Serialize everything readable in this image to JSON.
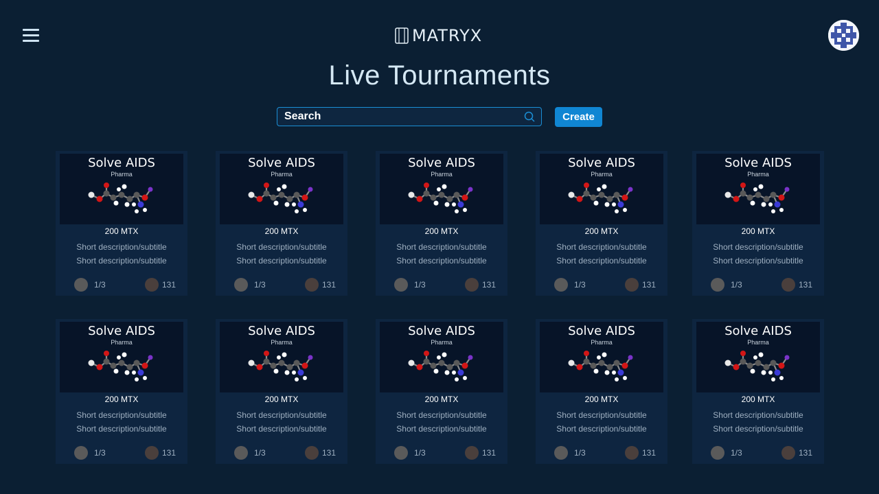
{
  "header": {
    "logo_text": "MATRYX",
    "title": "Live Tournaments"
  },
  "search": {
    "placeholder": "Search"
  },
  "toolbar": {
    "create_label": "Create"
  },
  "tournaments": [
    {
      "title": "Solve AIDS",
      "category": "Pharma",
      "reward": "200 MTX",
      "desc1": "Short description/subtitle",
      "desc2": "Short description/subtitle",
      "rounds": "1/3",
      "entries": "131"
    },
    {
      "title": "Solve AIDS",
      "category": "Pharma",
      "reward": "200 MTX",
      "desc1": "Short description/subtitle",
      "desc2": "Short description/subtitle",
      "rounds": "1/3",
      "entries": "131"
    },
    {
      "title": "Solve AIDS",
      "category": "Pharma",
      "reward": "200 MTX",
      "desc1": "Short description/subtitle",
      "desc2": "Short description/subtitle",
      "rounds": "1/3",
      "entries": "131"
    },
    {
      "title": "Solve AIDS",
      "category": "Pharma",
      "reward": "200 MTX",
      "desc1": "Short description/subtitle",
      "desc2": "Short description/subtitle",
      "rounds": "1/3",
      "entries": "131"
    },
    {
      "title": "Solve AIDS",
      "category": "Pharma",
      "reward": "200 MTX",
      "desc1": "Short description/subtitle",
      "desc2": "Short description/subtitle",
      "rounds": "1/3",
      "entries": "131"
    },
    {
      "title": "Solve AIDS",
      "category": "Pharma",
      "reward": "200 MTX",
      "desc1": "Short description/subtitle",
      "desc2": "Short description/subtitle",
      "rounds": "1/3",
      "entries": "131"
    },
    {
      "title": "Solve AIDS",
      "category": "Pharma",
      "reward": "200 MTX",
      "desc1": "Short description/subtitle",
      "desc2": "Short description/subtitle",
      "rounds": "1/3",
      "entries": "131"
    },
    {
      "title": "Solve AIDS",
      "category": "Pharma",
      "reward": "200 MTX",
      "desc1": "Short description/subtitle",
      "desc2": "Short description/subtitle",
      "rounds": "1/3",
      "entries": "131"
    },
    {
      "title": "Solve AIDS",
      "category": "Pharma",
      "reward": "200 MTX",
      "desc1": "Short description/subtitle",
      "desc2": "Short description/subtitle",
      "rounds": "1/3",
      "entries": "131"
    },
    {
      "title": "Solve AIDS",
      "category": "Pharma",
      "reward": "200 MTX",
      "desc1": "Short description/subtitle",
      "desc2": "Short description/subtitle",
      "rounds": "1/3",
      "entries": "131"
    }
  ],
  "colors": {
    "background": "#0b1f33",
    "card": "#0e2540",
    "accent": "#1086d3",
    "rounds_dot": "#5a5a5a",
    "entries_dot": "#4a3f3c"
  },
  "icons": {
    "menu": "hamburger-icon",
    "search": "search-icon",
    "logo": "matryx-logo-icon",
    "card_image": "molecule-icon"
  }
}
